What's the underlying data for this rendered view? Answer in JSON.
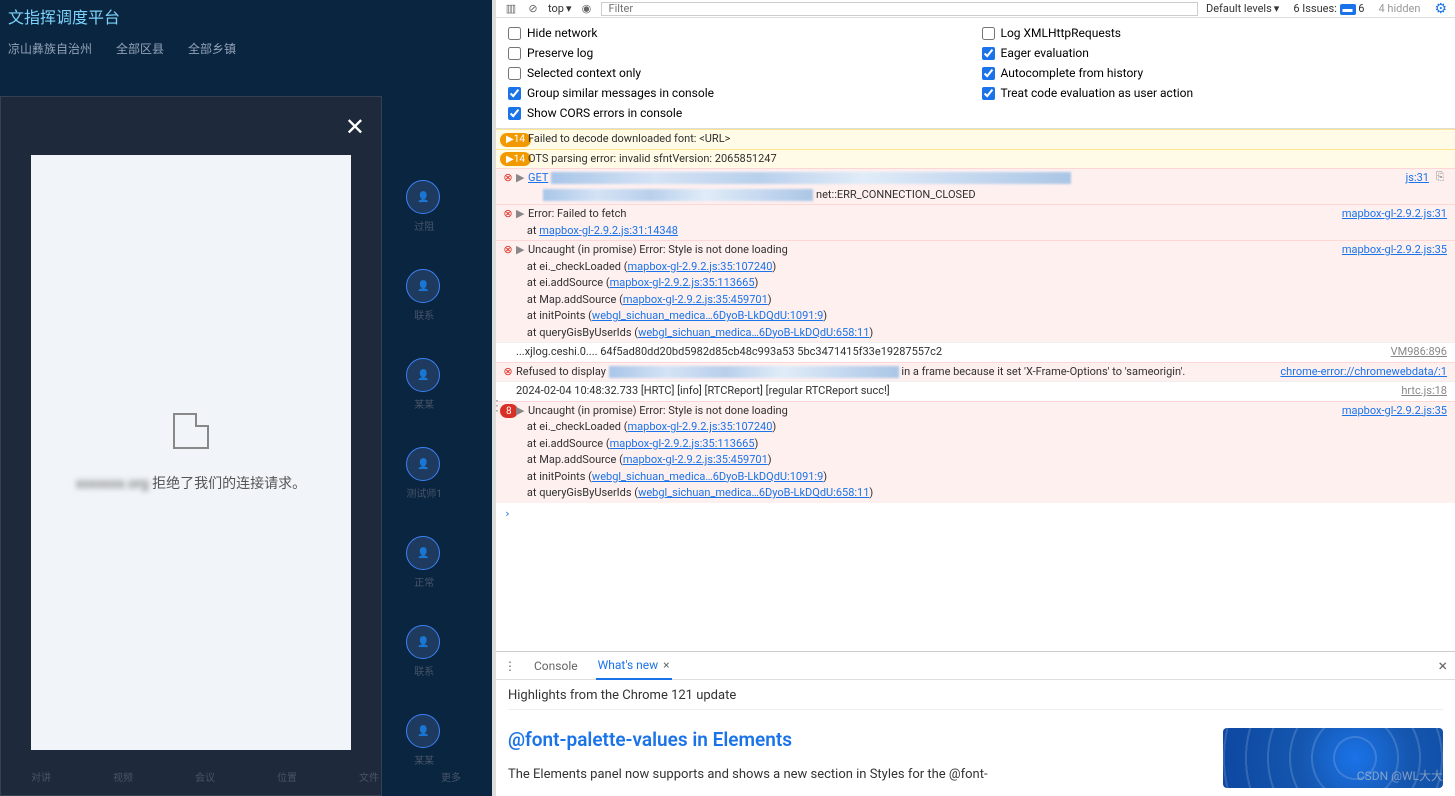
{
  "app": {
    "title": "文指挥调度平台"
  },
  "leftToolbar": [
    "凉山彝族自治州",
    "全部区县",
    "全部乡镇"
  ],
  "modal": {
    "refuseBlur": "xxxxxxx.org",
    "refuseText": " 拒绝了我们的连接请求。"
  },
  "avatars": [
    "过阻",
    "联系",
    "某某",
    "测试师1",
    "正常",
    "联系",
    "某某"
  ],
  "bottomNav": [
    "对讲",
    "视频",
    "会议",
    "位置",
    "文件",
    "更多"
  ],
  "toolbar": {
    "context": "top",
    "filterPlaceholder": "Filter",
    "levels": "Default levels",
    "issuesLabel": "6 Issues:",
    "issuesCount": "6",
    "hidden": "4 hidden"
  },
  "settings": {
    "hideNetwork": "Hide network",
    "preserveLog": "Preserve log",
    "selectedContext": "Selected context only",
    "groupSimilar": "Group similar messages in console",
    "showCors": "Show CORS errors in console",
    "logXhr": "Log XMLHttpRequests",
    "eagerEval": "Eager evaluation",
    "autocomplete": "Autocomplete from history",
    "treatCode": "Treat code evaluation as user action"
  },
  "logs": {
    "warn1": {
      "count": "14",
      "msg": "Failed to decode downloaded font: <URL>"
    },
    "warn2": {
      "count": "14",
      "msg": "OTS parsing error: invalid sfntVersion: 2065851247"
    },
    "err1": {
      "get": "GET",
      "suffix": " net::ERR_CONNECTION_CLOSED",
      "src": "js:31"
    },
    "err2": {
      "l1": "Error: Failed to fetch",
      "l2pre": "    at ",
      "l2link": "mapbox-gl-2.9.2.js:31:14348",
      "src": "mapbox-gl-2.9.2.js:31"
    },
    "err3": {
      "l1": "Uncaught (in promise) Error: Style is not done loading",
      "l2pre": "    at ei._checkLoaded (",
      "l2link": "mapbox-gl-2.9.2.js:35:107240",
      "l2suf": ")",
      "l3pre": "    at ei.addSource (",
      "l3link": "mapbox-gl-2.9.2.js:35:113665",
      "l3suf": ")",
      "l4pre": "    at Map.addSource (",
      "l4link": "mapbox-gl-2.9.2.js:35:459701",
      "l4suf": ")",
      "l5pre": "    at initPoints (",
      "l5link": "webgl_sichuan_medica…6DyoB-LkDQdU:1091:9",
      "l5suf": ")",
      "l6pre": "    at queryGisByUserIds (",
      "l6link": "webgl_sichuan_medica…6DyoB-LkDQdU:658:11",
      "l6suf": ")",
      "src": "mapbox-gl-2.9.2.js:35"
    },
    "info1": {
      "msg": "...xjlog.ceshi.0.... 64f5ad80dd20bd5982d85cb48c993a53 5bc3471415f33e19287557c2",
      "src": "VM986:896"
    },
    "err4": {
      "pre": "Refused to display ",
      "suf": " in a frame because it set 'X-Frame-Options' to 'sameorigin'.",
      "src": "chrome-error://chromewebdata/:1"
    },
    "info2": {
      "msg": "2024-02-04 10:48:32.733 [HRTC] [info] [RTCReport] [regular RTCReport succ!]",
      "src": "hrtc.js:18"
    },
    "err5": {
      "count": "8",
      "l1": "Uncaught (in promise) Error: Style is not done loading",
      "l2pre": "    at ei._checkLoaded (",
      "l2link": "mapbox-gl-2.9.2.js:35:107240",
      "l2suf": ")",
      "l3pre": "    at ei.addSource (",
      "l3link": "mapbox-gl-2.9.2.js:35:113665",
      "l3suf": ")",
      "l4pre": "    at Map.addSource (",
      "l4link": "mapbox-gl-2.9.2.js:35:459701",
      "l4suf": ")",
      "l5pre": "    at initPoints (",
      "l5link": "webgl_sichuan_medica…6DyoB-LkDQdU:1091:9",
      "l5suf": ")",
      "l6pre": "    at queryGisByUserIds (",
      "l6link": "webgl_sichuan_medica…6DyoB-LkDQdU:658:11",
      "l6suf": ")",
      "src": "mapbox-gl-2.9.2.js:35"
    }
  },
  "drawer": {
    "tabConsole": "Console",
    "tabWhatsNew": "What's new",
    "highlights": "Highlights from the Chrome 121 update",
    "wnTitle": "@font-palette-values in Elements",
    "wnDesc": "The Elements panel now supports and shows a new section in Styles for the @font-"
  },
  "watermark": "CSDN @WL大大"
}
